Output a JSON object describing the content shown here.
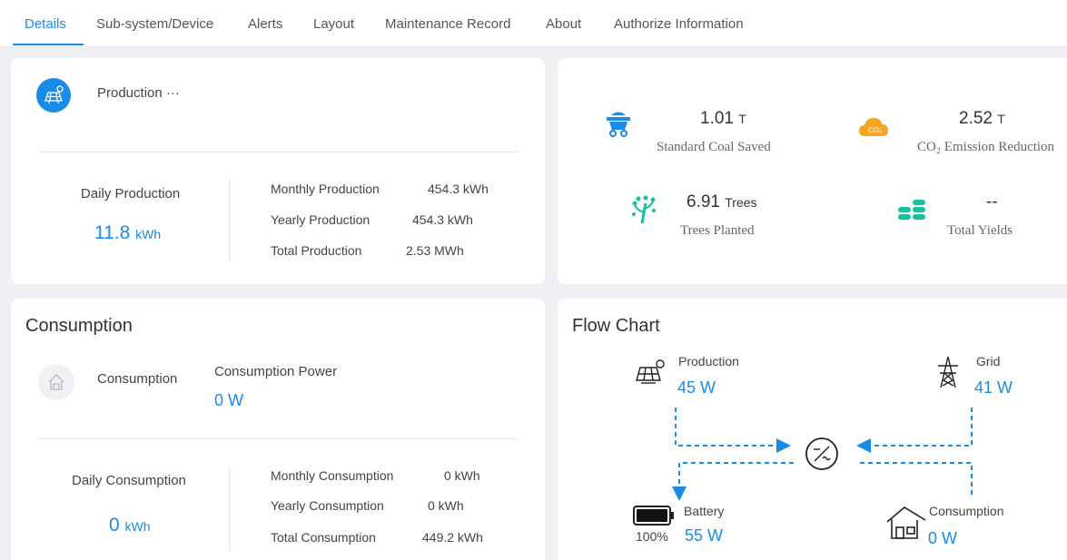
{
  "tabs": [
    {
      "label": "Details",
      "active": true
    },
    {
      "label": "Sub-system/Device"
    },
    {
      "label": "Alerts"
    },
    {
      "label": "Layout"
    },
    {
      "label": "Maintenance Record"
    },
    {
      "label": "About"
    },
    {
      "label": "Authorize Information"
    }
  ],
  "production": {
    "title": "Production ···",
    "daily_label": "Daily Production",
    "daily_value": "11.8",
    "daily_unit": "kWh",
    "monthly_label": "Monthly Production",
    "monthly_value": "454.3 kWh",
    "yearly_label": "Yearly Production",
    "yearly_value": "454.3 kWh",
    "total_label": "Total Production",
    "total_value": "2.53 MWh"
  },
  "environment": {
    "coal_value": "1.01",
    "coal_unit": "T",
    "coal_label": "Standard Coal Saved",
    "co2_value": "2.52",
    "co2_unit": "T",
    "co2_label": "CO₂ Emission Reduction",
    "co2_badge": "CO₂",
    "trees_value": "6.91",
    "trees_unit": "Trees",
    "trees_label": "Trees Planted",
    "yields_value": "--",
    "yields_label": "Total Yields"
  },
  "consumption": {
    "title": "Consumption",
    "icon_label": "Consumption",
    "power_label": "Consumption Power",
    "power_value": "0",
    "power_unit": "W",
    "daily_label": "Daily Consumption",
    "daily_value": "0",
    "daily_unit": "kWh",
    "monthly_label": "Monthly Consumption",
    "monthly_value": "0 kWh",
    "yearly_label": "Yearly Consumption",
    "yearly_value": "0 kWh",
    "total_label": "Total Consumption",
    "total_value": "449.2 kWh"
  },
  "flow": {
    "title": "Flow Chart",
    "production_label": "Production",
    "production_value": "45 W",
    "grid_label": "Grid",
    "grid_value": "41 W",
    "battery_label": "Battery",
    "battery_value": "55 W",
    "battery_percent": "100%",
    "consumption_label": "Consumption",
    "consumption_value": "0 W"
  },
  "colors": {
    "accent": "#1a8be6",
    "eco_green": "#12c2a0",
    "co2_orange": "#f5a623",
    "background": "#eef0f4"
  },
  "icons": [
    "solar-panel-icon",
    "coal-cart-icon",
    "co2-cloud-icon",
    "tree-icon",
    "coins-icon",
    "house-icon",
    "transmission-tower-icon",
    "battery-icon",
    "inverter-icon"
  ]
}
